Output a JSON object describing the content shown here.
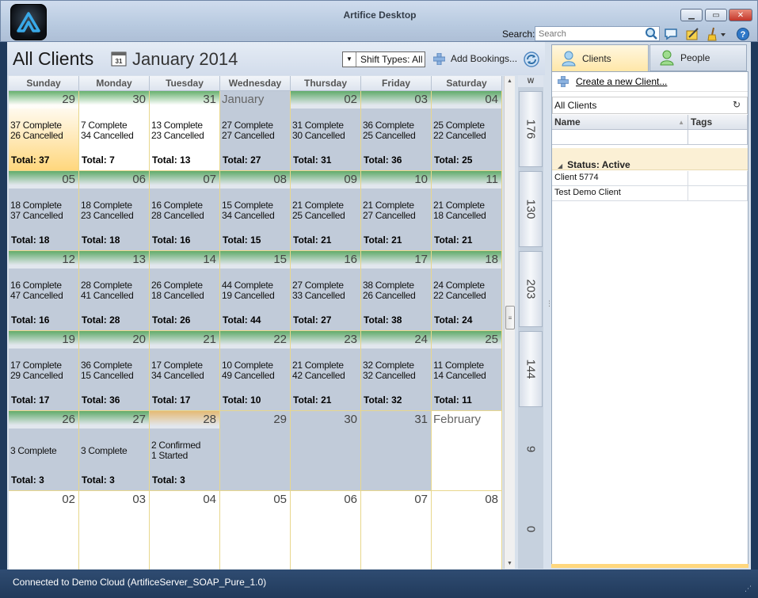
{
  "window": {
    "title": "Artifice Desktop",
    "search_label": "Search:",
    "search_placeholder": "Search"
  },
  "header": {
    "title": "All Clients",
    "month": "January 2014",
    "shift_filter": "Shift Types: All",
    "add_bookings": "Add Bookings..."
  },
  "calendar": {
    "days": [
      "Sunday",
      "Monday",
      "Tuesday",
      "Wednesday",
      "Thursday",
      "Friday",
      "Saturday"
    ],
    "weeks_header": "W",
    "weeks": [
      [
        {
          "num": "29",
          "line1": "37 Complete",
          "line2": "26 Cancelled",
          "total": "Total: 37",
          "style": "today",
          "bar": "green"
        },
        {
          "num": "30",
          "line1": "7 Complete",
          "line2": "34 Cancelled",
          "total": "Total: 7",
          "style": "white",
          "bar": "green"
        },
        {
          "num": "31",
          "line1": "13 Complete",
          "line2": "23 Cancelled",
          "total": "Total: 13",
          "style": "white",
          "bar": "green"
        },
        {
          "num": "",
          "month_name": "January",
          "line1": "27 Complete",
          "line2": "27 Cancelled",
          "total": "Total: 27",
          "style": "gray",
          "bar": "none"
        },
        {
          "num": "02",
          "line1": "31 Complete",
          "line2": "30 Cancelled",
          "total": "Total: 31",
          "style": "gray",
          "bar": "green"
        },
        {
          "num": "03",
          "line1": "36 Complete",
          "line2": "25 Cancelled",
          "total": "Total: 36",
          "style": "gray",
          "bar": "green"
        },
        {
          "num": "04",
          "line1": "25 Complete",
          "line2": "22 Cancelled",
          "total": "Total: 25",
          "style": "gray",
          "bar": "green"
        }
      ],
      [
        {
          "num": "05",
          "line1": "18 Complete",
          "line2": "37 Cancelled",
          "total": "Total: 18",
          "style": "gray",
          "bar": "green"
        },
        {
          "num": "06",
          "line1": "18 Complete",
          "line2": "23 Cancelled",
          "total": "Total: 18",
          "style": "gray",
          "bar": "green"
        },
        {
          "num": "07",
          "line1": "16 Complete",
          "line2": "28 Cancelled",
          "total": "Total: 16",
          "style": "gray",
          "bar": "green"
        },
        {
          "num": "08",
          "line1": "15 Complete",
          "line2": "34 Cancelled",
          "total": "Total: 15",
          "style": "gray",
          "bar": "green"
        },
        {
          "num": "09",
          "line1": "21 Complete",
          "line2": "25 Cancelled",
          "total": "Total: 21",
          "style": "gray",
          "bar": "green"
        },
        {
          "num": "10",
          "line1": "21 Complete",
          "line2": "27 Cancelled",
          "total": "Total: 21",
          "style": "gray",
          "bar": "green"
        },
        {
          "num": "11",
          "line1": "21 Complete",
          "line2": "18 Cancelled",
          "total": "Total: 21",
          "style": "gray",
          "bar": "green"
        }
      ],
      [
        {
          "num": "12",
          "line1": "16 Complete",
          "line2": "47 Cancelled",
          "total": "Total: 16",
          "style": "gray",
          "bar": "green"
        },
        {
          "num": "13",
          "line1": "28 Complete",
          "line2": "41 Cancelled",
          "total": "Total: 28",
          "style": "gray",
          "bar": "green"
        },
        {
          "num": "14",
          "line1": "26 Complete",
          "line2": "18 Cancelled",
          "total": "Total: 26",
          "style": "gray",
          "bar": "green"
        },
        {
          "num": "15",
          "line1": "44 Complete",
          "line2": "19 Cancelled",
          "total": "Total: 44",
          "style": "gray",
          "bar": "green"
        },
        {
          "num": "16",
          "line1": "27 Complete",
          "line2": "33 Cancelled",
          "total": "Total: 27",
          "style": "gray",
          "bar": "green"
        },
        {
          "num": "17",
          "line1": "38 Complete",
          "line2": "26 Cancelled",
          "total": "Total: 38",
          "style": "gray",
          "bar": "green"
        },
        {
          "num": "18",
          "line1": "24 Complete",
          "line2": "22 Cancelled",
          "total": "Total: 24",
          "style": "gray",
          "bar": "green"
        }
      ],
      [
        {
          "num": "19",
          "line1": "17 Complete",
          "line2": "29 Cancelled",
          "total": "Total: 17",
          "style": "gray",
          "bar": "green"
        },
        {
          "num": "20",
          "line1": "36 Complete",
          "line2": "15 Cancelled",
          "total": "Total: 36",
          "style": "gray",
          "bar": "green"
        },
        {
          "num": "21",
          "line1": "17 Complete",
          "line2": "34 Cancelled",
          "total": "Total: 17",
          "style": "gray",
          "bar": "green"
        },
        {
          "num": "22",
          "line1": "10 Complete",
          "line2": "49 Cancelled",
          "total": "Total: 10",
          "style": "gray",
          "bar": "green"
        },
        {
          "num": "23",
          "line1": "21 Complete",
          "line2": "42 Cancelled",
          "total": "Total: 21",
          "style": "gray",
          "bar": "green"
        },
        {
          "num": "24",
          "line1": "32 Complete",
          "line2": "32 Cancelled",
          "total": "Total: 32",
          "style": "gray",
          "bar": "green"
        },
        {
          "num": "25",
          "line1": "11 Complete",
          "line2": "14 Cancelled",
          "total": "Total: 11",
          "style": "gray",
          "bar": "green"
        }
      ],
      [
        {
          "num": "26",
          "line1": "3 Complete",
          "line2": "",
          "total": "Total: 3",
          "style": "gray",
          "bar": "green",
          "single": true
        },
        {
          "num": "27",
          "line1": "3 Complete",
          "line2": "",
          "total": "Total: 3",
          "style": "gray",
          "bar": "green",
          "single": true
        },
        {
          "num": "28",
          "line1": "2 Confirmed",
          "line2": "1 Started",
          "total": "Total: 3",
          "style": "gray",
          "bar": "orange"
        },
        {
          "num": "29",
          "line1": "",
          "line2": "",
          "total": "",
          "style": "gray",
          "bar": "none"
        },
        {
          "num": "30",
          "line1": "",
          "line2": "",
          "total": "",
          "style": "gray",
          "bar": "none"
        },
        {
          "num": "31",
          "line1": "",
          "line2": "",
          "total": "",
          "style": "gray",
          "bar": "none"
        },
        {
          "num": "",
          "month_name": "February",
          "line1": "",
          "line2": "",
          "total": "",
          "style": "white",
          "bar": "none"
        }
      ],
      [
        {
          "num": "02",
          "line1": "",
          "line2": "",
          "total": "",
          "style": "white",
          "bar": "none"
        },
        {
          "num": "03",
          "line1": "",
          "line2": "",
          "total": "",
          "style": "white",
          "bar": "none"
        },
        {
          "num": "04",
          "line1": "",
          "line2": "",
          "total": "",
          "style": "white",
          "bar": "none"
        },
        {
          "num": "05",
          "line1": "",
          "line2": "",
          "total": "",
          "style": "white",
          "bar": "none"
        },
        {
          "num": "06",
          "line1": "",
          "line2": "",
          "total": "",
          "style": "white",
          "bar": "none"
        },
        {
          "num": "07",
          "line1": "",
          "line2": "",
          "total": "",
          "style": "white",
          "bar": "none"
        },
        {
          "num": "08",
          "line1": "",
          "line2": "",
          "total": "",
          "style": "white",
          "bar": "none"
        }
      ]
    ],
    "week_totals": [
      "176",
      "130",
      "203",
      "144",
      "9",
      "0"
    ]
  },
  "right_panel": {
    "tabs": [
      "Clients",
      "People"
    ],
    "create_link": "Create a new Client...",
    "filter_value": "All Clients",
    "columns": [
      "Name",
      "Tags"
    ],
    "group_label": "Status: Active",
    "rows": [
      {
        "name": "Client 5774",
        "tags": ""
      },
      {
        "name": "Test Demo Client",
        "tags": ""
      }
    ]
  },
  "status": {
    "text": "Connected to Demo Cloud (ArtificeServer_SOAP_Pure_1.0)"
  },
  "colors": {
    "accent": "#ffd77d",
    "cell_gray": "#c1cbd9",
    "title_bar": "#b8cae0",
    "status_bar": "#2a4468"
  }
}
